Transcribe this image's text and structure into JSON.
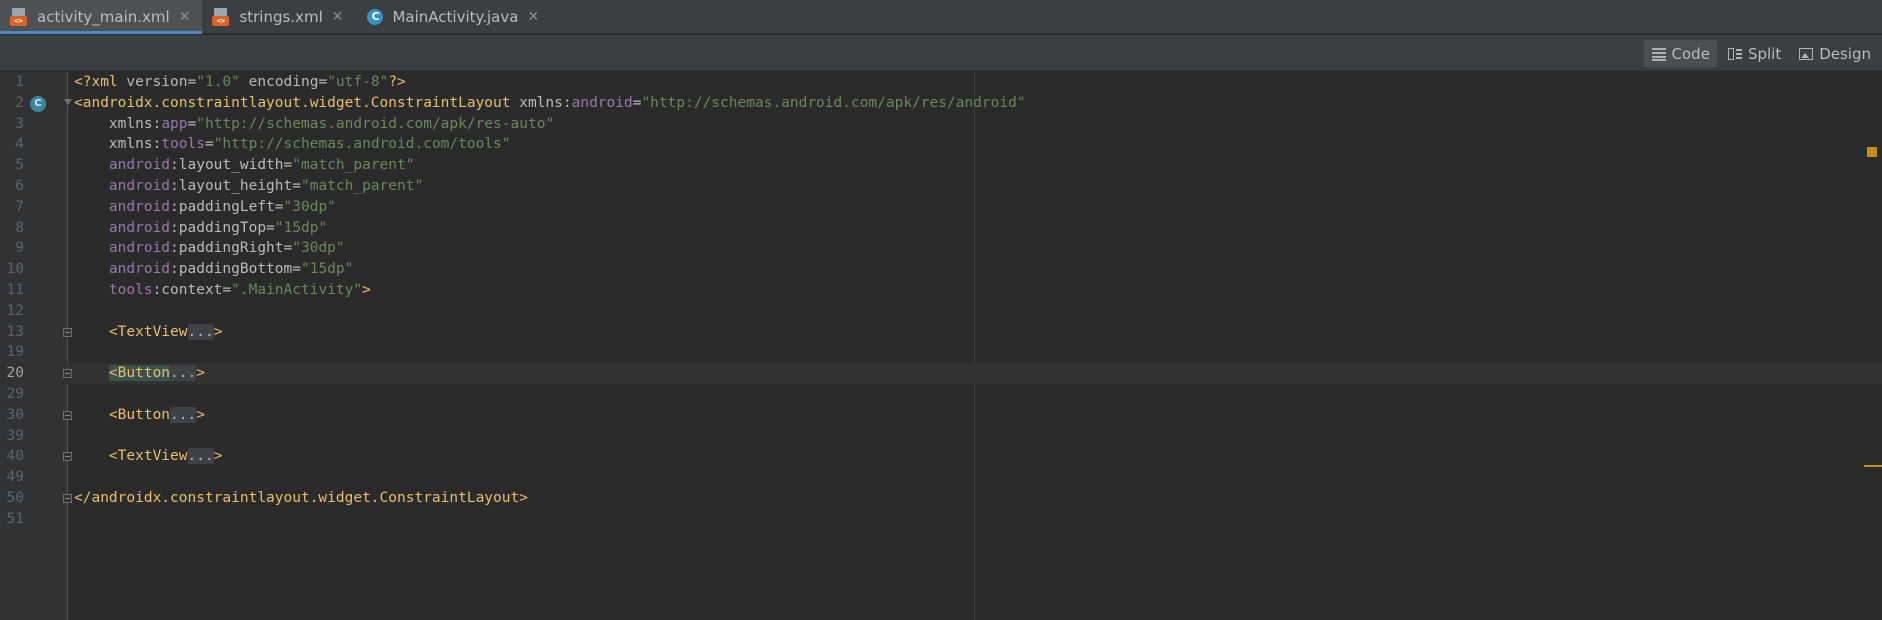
{
  "tabs": [
    {
      "label": "activity_main.xml",
      "icon": "xml-file-icon",
      "active": true
    },
    {
      "label": "strings.xml",
      "icon": "xml-file-icon",
      "active": false
    },
    {
      "label": "MainActivity.java",
      "icon": "java-class-icon",
      "active": false
    }
  ],
  "view_modes": [
    {
      "label": "Code",
      "icon": "code-view-icon",
      "selected": true
    },
    {
      "label": "Split",
      "icon": "split-view-icon",
      "selected": false
    },
    {
      "label": "Design",
      "icon": "design-view-icon",
      "selected": false
    }
  ],
  "gutter_badge": "C",
  "lines": [
    {
      "num": "1",
      "tokens": [
        [
          "tag",
          "<?xml "
        ],
        [
          "attr",
          "version="
        ],
        [
          "val",
          "\"1.0\" "
        ],
        [
          "attr",
          "encoding="
        ],
        [
          "val",
          "\"utf-8\""
        ],
        [
          "tag",
          "?>"
        ]
      ]
    },
    {
      "num": "2",
      "tokens": [
        [
          "tag",
          "<androidx.constraintlayout.widget.ConstraintLayout "
        ],
        [
          "attr",
          "xmlns:"
        ],
        [
          "ns",
          "android"
        ],
        [
          "attr",
          "="
        ],
        [
          "val",
          "\"http://schemas.android.com/apk/res/android\""
        ]
      ]
    },
    {
      "num": "3",
      "tokens": [
        [
          "attr",
          "    xmlns:"
        ],
        [
          "ns",
          "app"
        ],
        [
          "attr",
          "="
        ],
        [
          "val",
          "\"http://schemas.android.com/apk/res-auto\""
        ]
      ]
    },
    {
      "num": "4",
      "tokens": [
        [
          "attr",
          "    xmlns:"
        ],
        [
          "ns",
          "tools"
        ],
        [
          "attr",
          "="
        ],
        [
          "val",
          "\"http://schemas.android.com/tools\""
        ]
      ]
    },
    {
      "num": "5",
      "tokens": [
        [
          "ns",
          "    android"
        ],
        [
          "attr",
          ":layout_width="
        ],
        [
          "val",
          "\"match_parent\""
        ]
      ]
    },
    {
      "num": "6",
      "tokens": [
        [
          "ns",
          "    android"
        ],
        [
          "attr",
          ":layout_height="
        ],
        [
          "val",
          "\"match_parent\""
        ]
      ]
    },
    {
      "num": "7",
      "tokens": [
        [
          "ns",
          "    android"
        ],
        [
          "attr",
          ":paddingLeft="
        ],
        [
          "val",
          "\"30dp\""
        ]
      ]
    },
    {
      "num": "8",
      "tokens": [
        [
          "ns",
          "    android"
        ],
        [
          "attr",
          ":paddingTop="
        ],
        [
          "val",
          "\"15dp\""
        ]
      ]
    },
    {
      "num": "9",
      "tokens": [
        [
          "ns",
          "    android"
        ],
        [
          "attr",
          ":paddingRight="
        ],
        [
          "val",
          "\"30dp\""
        ]
      ]
    },
    {
      "num": "10",
      "tokens": [
        [
          "ns",
          "    android"
        ],
        [
          "attr",
          ":paddingBottom="
        ],
        [
          "val",
          "\"15dp\""
        ]
      ]
    },
    {
      "num": "11",
      "tokens": [
        [
          "ns",
          "    tools"
        ],
        [
          "attr",
          ":context="
        ],
        [
          "val",
          "\".MainActivity\""
        ],
        [
          "tag",
          ">"
        ]
      ]
    },
    {
      "num": "12",
      "tokens": []
    },
    {
      "num": "13",
      "tokens": [
        [
          "tag",
          "    <TextView"
        ],
        [
          "dots",
          "..."
        ],
        [
          "tag",
          ">"
        ]
      ]
    },
    {
      "num": "19",
      "tokens": []
    },
    {
      "num": "20",
      "tokens": [
        [
          "plain",
          "    "
        ],
        [
          "hl",
          "<Button"
        ],
        [
          "dots",
          "..."
        ],
        [
          "tag",
          ">"
        ]
      ]
    },
    {
      "num": "29",
      "tokens": []
    },
    {
      "num": "30",
      "tokens": [
        [
          "tag",
          "    <Button"
        ],
        [
          "dots",
          "..."
        ],
        [
          "tag",
          ">"
        ]
      ]
    },
    {
      "num": "39",
      "tokens": []
    },
    {
      "num": "40",
      "tokens": [
        [
          "tag",
          "    <TextView"
        ],
        [
          "dots",
          "..."
        ],
        [
          "tag",
          ">"
        ]
      ]
    },
    {
      "num": "49",
      "tokens": []
    },
    {
      "num": "50",
      "tokens": [
        [
          "tag",
          "</androidx.constraintlayout.widget.ConstraintLayout>"
        ]
      ]
    },
    {
      "num": "51",
      "tokens": []
    }
  ]
}
